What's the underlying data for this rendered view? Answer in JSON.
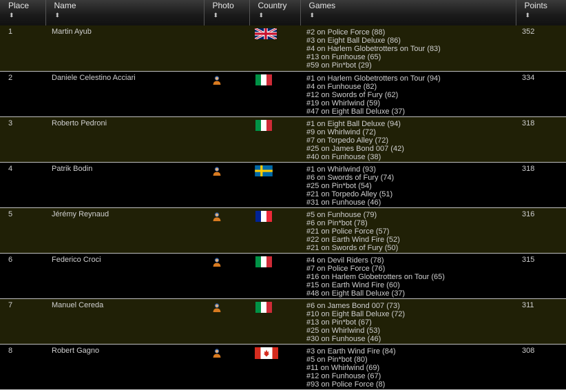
{
  "headers": {
    "place": "Place",
    "name": "Name",
    "photo": "Photo",
    "country": "Country",
    "games": "Games",
    "points": "Points",
    "sort_glyph": "⬍"
  },
  "rows": [
    {
      "place": "1",
      "name": "Martin Ayub",
      "photo": false,
      "country": "uk",
      "points": "352",
      "games": [
        "#2 on Police Force (88)",
        "#3 on Eight Ball Deluxe (86)",
        "#4 on Harlem Globetrotters on Tour (83)",
        "#13 on Funhouse (65)",
        "#59 on Pin*bot (29)"
      ]
    },
    {
      "place": "2",
      "name": "Daniele Celestino Acciari",
      "photo": true,
      "country": "it",
      "points": "334",
      "games": [
        "#1 on Harlem Globetrotters on Tour (94)",
        "#4 on Funhouse (82)",
        "#12 on Swords of Fury (62)",
        "#19 on Whirlwind (59)",
        "#47 on Eight Ball Deluxe (37)"
      ]
    },
    {
      "place": "3",
      "name": "Roberto Pedroni",
      "photo": false,
      "country": "it",
      "points": "318",
      "games": [
        "#1 on Eight Ball Deluxe (94)",
        "#9 on Whirlwind (72)",
        "#7 on Torpedo Alley (72)",
        "#25 on James Bond 007 (42)",
        "#40 on Funhouse (38)"
      ]
    },
    {
      "place": "4",
      "name": "Patrik Bodin",
      "photo": true,
      "country": "se",
      "points": "318",
      "games": [
        "#1 on Whirlwind (93)",
        "#6 on Swords of Fury (74)",
        "#25 on Pin*bot (54)",
        "#21 on Torpedo Alley (51)",
        "#31 on Funhouse (46)"
      ]
    },
    {
      "place": "5",
      "name": "Jérémy Reynaud",
      "photo": true,
      "country": "fr",
      "points": "316",
      "games": [
        "#5 on Funhouse (79)",
        "#6 on Pin*bot (78)",
        "#21 on Police Force (57)",
        "#22 on Earth Wind Fire (52)",
        "#21 on Swords of Fury (50)"
      ]
    },
    {
      "place": "6",
      "name": "Federico Croci",
      "photo": true,
      "country": "it",
      "points": "315",
      "games": [
        "#4 on Devil Riders (78)",
        "#7 on Police Force (76)",
        "#16 on Harlem Globetrotters on Tour (65)",
        "#15 on Earth Wind Fire (60)",
        "#48 on Eight Ball Deluxe (37)"
      ]
    },
    {
      "place": "7",
      "name": "Manuel Cereda",
      "photo": true,
      "country": "it",
      "points": "311",
      "games": [
        "#6 on James Bond 007 (73)",
        "#10 on Eight Ball Deluxe (72)",
        "#13 on Pin*bot (67)",
        "#25 on Whirlwind (53)",
        "#30 on Funhouse (46)"
      ]
    },
    {
      "place": "8",
      "name": "Robert Gagno",
      "photo": true,
      "country": "ca",
      "points": "308",
      "games": [
        "#3 on Earth Wind Fire (84)",
        "#5 on Pin*bot (80)",
        "#11 on Whirlwind (69)",
        "#12 on Funhouse (67)",
        "#93 on Police Force (8)"
      ]
    }
  ],
  "colors": {
    "row_odd": "#202006",
    "row_even": "#000000",
    "text": "#cfcfcf"
  }
}
